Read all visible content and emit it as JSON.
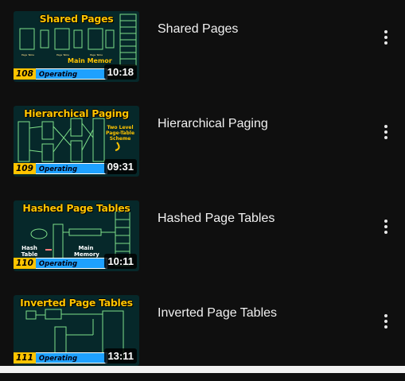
{
  "videos": [
    {
      "title": "Shared Pages",
      "duration": "10:18",
      "thumb_title": "Shared Pages",
      "thumb_number": "108",
      "thumb_series": "Operating System",
      "thumb_note": "Main Memor",
      "thumb_icon": "shared-pages-diagram"
    },
    {
      "title": "Hierarchical Paging",
      "duration": "09:31",
      "thumb_title": "Hierarchical Paging",
      "thumb_number": "109",
      "thumb_series": "Operating System",
      "thumb_note": "Two Level Page-Table Scheme",
      "thumb_icon": "hierarchical-paging-diagram"
    },
    {
      "title": "Hashed Page Tables",
      "duration": "10:11",
      "thumb_title": "Hashed Page Tables",
      "thumb_number": "110",
      "thumb_series": "Operating System",
      "thumb_note": "Main Memory",
      "thumb_note2": "Hash Table",
      "thumb_icon": "hashed-page-table-diagram"
    },
    {
      "title": "Inverted Page Tables",
      "duration": "13:11",
      "thumb_title": "Inverted Page Tables",
      "thumb_number": "111",
      "thumb_series": "Operating System",
      "thumb_icon": "inverted-page-table-diagram"
    }
  ],
  "colors": {
    "background": "#0f0f0f",
    "thumb_title": "#ffc400",
    "thumb_series": "#1ea1ff",
    "diagram_lines": "#7fe08a"
  },
  "menu_icon": "more-vert-icon"
}
